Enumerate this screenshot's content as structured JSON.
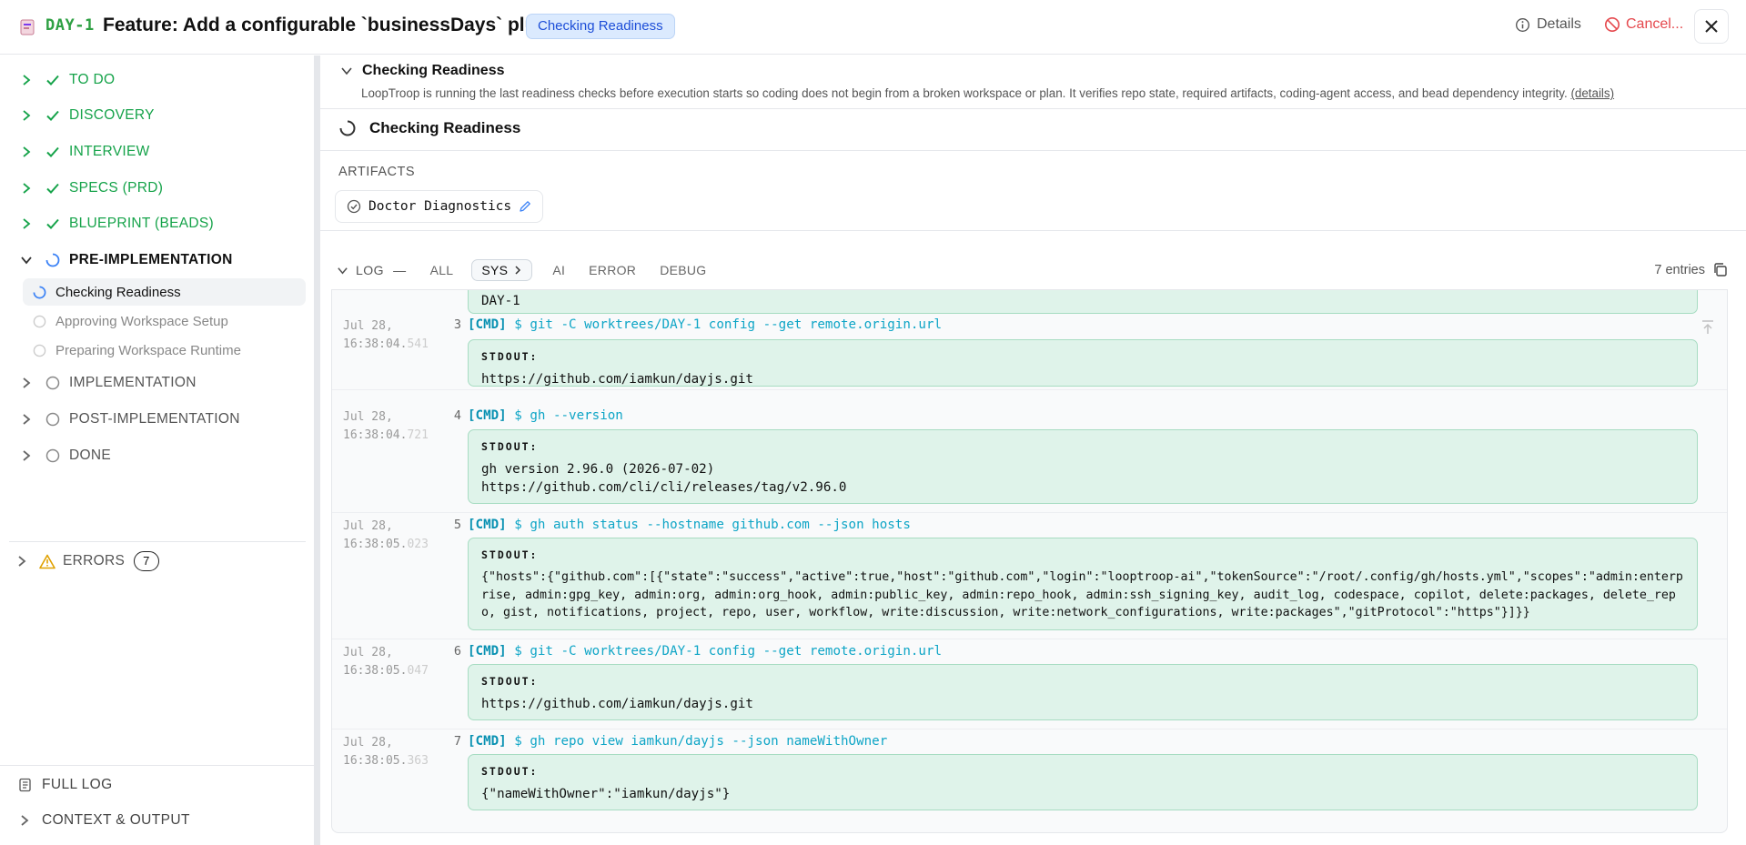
{
  "header": {
    "ticket_id": "DAY-1",
    "title": "Feature: Add a configurable `businessDays` plugin",
    "status_badge": "Checking Readiness",
    "details_label": "Details",
    "cancel_label": "Cancel..."
  },
  "sidebar": {
    "phases": [
      {
        "label": "TO DO",
        "state": "done"
      },
      {
        "label": "DISCOVERY",
        "state": "done"
      },
      {
        "label": "INTERVIEW",
        "state": "done"
      },
      {
        "label": "SPECS (PRD)",
        "state": "done"
      },
      {
        "label": "BLUEPRINT (BEADS)",
        "state": "done"
      },
      {
        "label": "PRE-IMPLEMENTATION",
        "state": "active"
      },
      {
        "label": "IMPLEMENTATION",
        "state": "pending"
      },
      {
        "label": "POST-IMPLEMENTATION",
        "state": "pending"
      },
      {
        "label": "DONE",
        "state": "pending"
      }
    ],
    "subitems": [
      {
        "label": "Checking Readiness",
        "state": "current"
      },
      {
        "label": "Approving Workspace Setup",
        "state": "pending"
      },
      {
        "label": "Preparing Workspace Runtime",
        "state": "pending"
      }
    ],
    "errors_label": "ERRORS",
    "errors_count": "7",
    "full_log_label": "FULL LOG",
    "context_output_label": "CONTEXT & OUTPUT"
  },
  "main": {
    "section_title": "Checking Readiness",
    "section_desc": "LoopTroop is running the last readiness checks before execution starts so coding does not begin from a broken workspace or plan. It verifies repo state, required artifacts, coding-agent access, and bead dependency integrity.",
    "details_link": "(details)",
    "status_title": "Checking Readiness",
    "artifacts_label": "ARTIFACTS",
    "artifact_name": "Doctor Diagnostics",
    "log": {
      "label": "LOG",
      "dash": "—",
      "filters": [
        "ALL",
        "SYS",
        "AI",
        "ERROR",
        "DEBUG"
      ],
      "selected_filter": "SYS",
      "entries_label": "7 entries",
      "prev_output_tail": "DAY-1",
      "rows": [
        {
          "date": "Jul 28,",
          "time": "16:38:04.",
          "ms": "541",
          "num": "3",
          "tag": "[CMD]",
          "cmd": "$ git -C worktrees/DAY-1 config --get remote.origin.url",
          "stdout_label": "STDOUT:",
          "stdout": "https://github.com/iamkun/dayjs.git"
        },
        {
          "date": "Jul 28,",
          "time": "16:38:04.",
          "ms": "721",
          "num": "4",
          "tag": "[CMD]",
          "cmd": "$ gh --version",
          "stdout_label": "STDOUT:",
          "stdout": "gh version 2.96.0 (2026-07-02)\nhttps://github.com/cli/cli/releases/tag/v2.96.0"
        },
        {
          "date": "Jul 28,",
          "time": "16:38:05.",
          "ms": "023",
          "num": "5",
          "tag": "[CMD]",
          "cmd": "$ gh auth status --hostname github.com --json hosts",
          "stdout_label": "STDOUT:",
          "stdout": "{\"hosts\":{\"github.com\":[{\"state\":\"success\",\"active\":true,\"host\":\"github.com\",\"login\":\"looptroop-ai\",\"tokenSource\":\"/root/.config/gh/hosts.yml\",\"scopes\":\"admin:enterprise, admin:gpg_key, admin:org, admin:org_hook, admin:public_key, admin:repo_hook, admin:ssh_signing_key, audit_log, codespace, copilot, delete:packages, delete_repo, gist, notifications, project, repo, user, workflow, write:discussion, write:network_configurations, write:packages\",\"gitProtocol\":\"https\"}]}}"
        },
        {
          "date": "Jul 28,",
          "time": "16:38:05.",
          "ms": "047",
          "num": "6",
          "tag": "[CMD]",
          "cmd": "$ git -C worktrees/DAY-1 config --get remote.origin.url",
          "stdout_label": "STDOUT:",
          "stdout": "https://github.com/iamkun/dayjs.git"
        },
        {
          "date": "Jul 28,",
          "time": "16:38:05.",
          "ms": "363",
          "num": "7",
          "tag": "[CMD]",
          "cmd": "$ gh repo view iamkun/dayjs --json nameWithOwner",
          "stdout_label": "STDOUT:",
          "stdout": "{\"nameWithOwner\":\"iamkun/dayjs\"}"
        }
      ]
    }
  },
  "colors": {
    "done_green": "#16a34a",
    "accent_blue": "#1d4ed8",
    "cancel_red": "#e5484d",
    "cmd_cyan": "#0891b2",
    "stdout_bg": "#dff3ea"
  }
}
